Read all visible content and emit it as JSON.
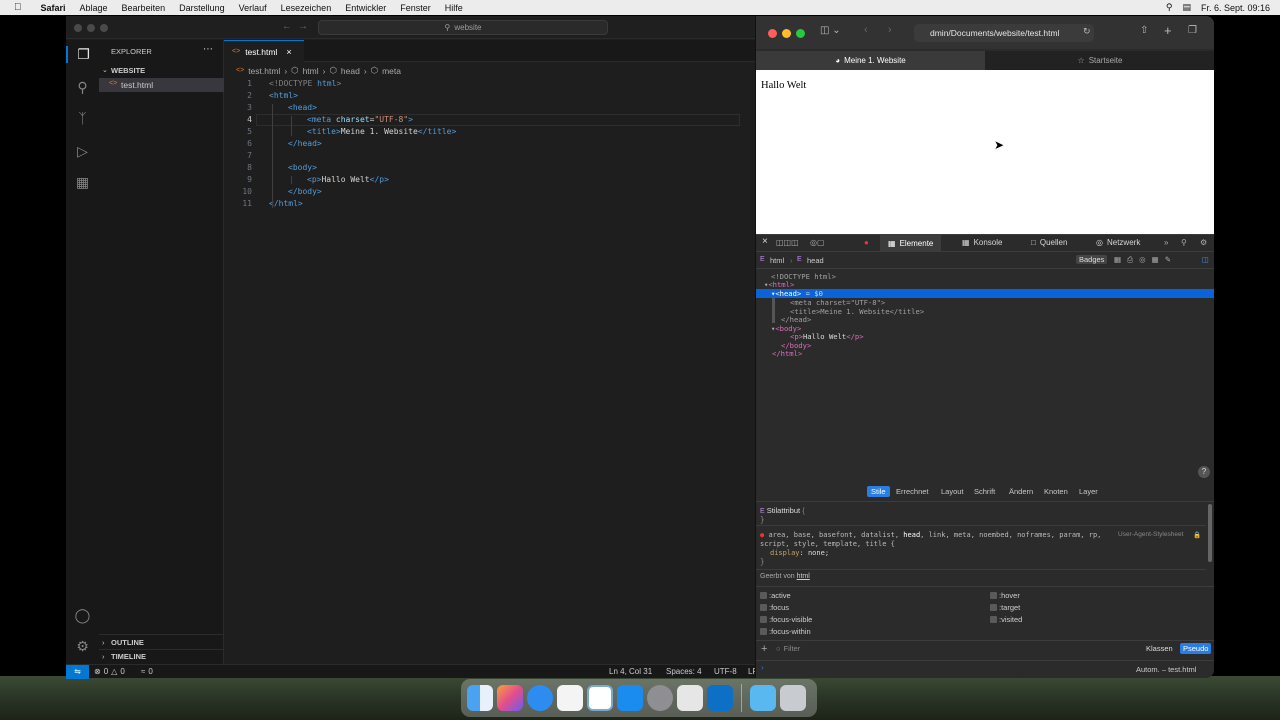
{
  "menubar": {
    "app": "Safari",
    "items": [
      "Ablage",
      "Bearbeiten",
      "Darstellung",
      "Verlauf",
      "Lesezeichen",
      "Entwickler",
      "Fenster",
      "Hilfe"
    ],
    "datetime": "Fr. 6. Sept. 09:16"
  },
  "vscode": {
    "search": "website",
    "explorer_title": "EXPLORER",
    "folder": "WEBSITE",
    "file": "test.html",
    "tab": "test.html",
    "breadcrumbs": [
      "test.html",
      "html",
      "head",
      "meta"
    ],
    "line_numbers": [
      "1",
      "2",
      "3",
      "4",
      "5",
      "6",
      "7",
      "8",
      "9",
      "10",
      "11"
    ],
    "code": {
      "l1a": "<!DOCTYPE ",
      "l1b": "html",
      "l1c": ">",
      "l2": "<html>",
      "l3": "<head>",
      "l4a": "<meta ",
      "l4b": "charset",
      "l4c": "=",
      "l4d": "\"UTF-8\"",
      "l4e": ">",
      "l5a": "<title>",
      "l5b": "Meine 1. Website",
      "l5c": "</title>",
      "l6": "</head>",
      "l8": "<body>",
      "l9a": "<p>",
      "l9b": "Hallo Welt",
      "l9c": "</p>",
      "l10": "</body>",
      "l11": "</html>"
    },
    "outline": "OUTLINE",
    "timeline": "TIMELINE",
    "status": {
      "errors": "0",
      "warnings": "0",
      "ports": "0",
      "position": "Ln 4, Col 31",
      "spaces": "Spaces: 4",
      "encoding": "UTF-8",
      "eol": "LF"
    }
  },
  "safari": {
    "url": "dmin/Documents/website/test.html",
    "tab1": "Meine 1. Website",
    "tab2": "Startseite",
    "page_text": "Hallo Welt",
    "devtools": {
      "tabs": [
        "Elemente",
        "Konsole",
        "Quellen",
        "Netzwerk"
      ],
      "path": [
        "html",
        "head"
      ],
      "badges": "Badges",
      "dom": {
        "d1": "<!DOCTYPE html>",
        "d2": "<html>",
        "d3a": "<head>",
        "d3b": " = $0",
        "d4a": "<meta ",
        "d4b": "charset",
        "d4c": "=\"",
        "d4d": "UTF-8",
        "d4e": "\">",
        "d5a": "<title>",
        "d5b": "Meine 1. Website",
        "d5c": "</title>",
        "d6": "</head>",
        "d7": "<body>",
        "d8a": "<p>",
        "d8b": "Hallo Welt",
        "d8c": "</p>",
        "d9": "</body>",
        "d10": "</html>"
      },
      "sidebar_tabs": [
        "Stile",
        "Errechnet",
        "Layout",
        "Schrift",
        "Ändern",
        "Knoten",
        "Layer"
      ],
      "style_attr": "Stilattribut",
      "brace_open": "{",
      "brace_close": "}",
      "ua_selector_a": "area, base, basefont, datalist, ",
      "ua_selector_head": "head",
      "ua_selector_b": ", link, meta, noembed, noframes, param, rp,",
      "ua_selector_c": "script, style, template, title {",
      "ua_source": "User-Agent-Stylesheet",
      "ua_prop": "display",
      "ua_val": "none",
      "inherited_label": "Geerbt von",
      "inherited_from": "html",
      "pseudo_left": [
        ":active",
        ":focus",
        ":focus-visible",
        ":focus-within"
      ],
      "pseudo_right": [
        ":hover",
        ":target",
        ":visited"
      ],
      "filter": "Filter",
      "classes": "Klassen",
      "pseudo": "Pseudo",
      "console_context": "Autom. – test.html"
    }
  }
}
